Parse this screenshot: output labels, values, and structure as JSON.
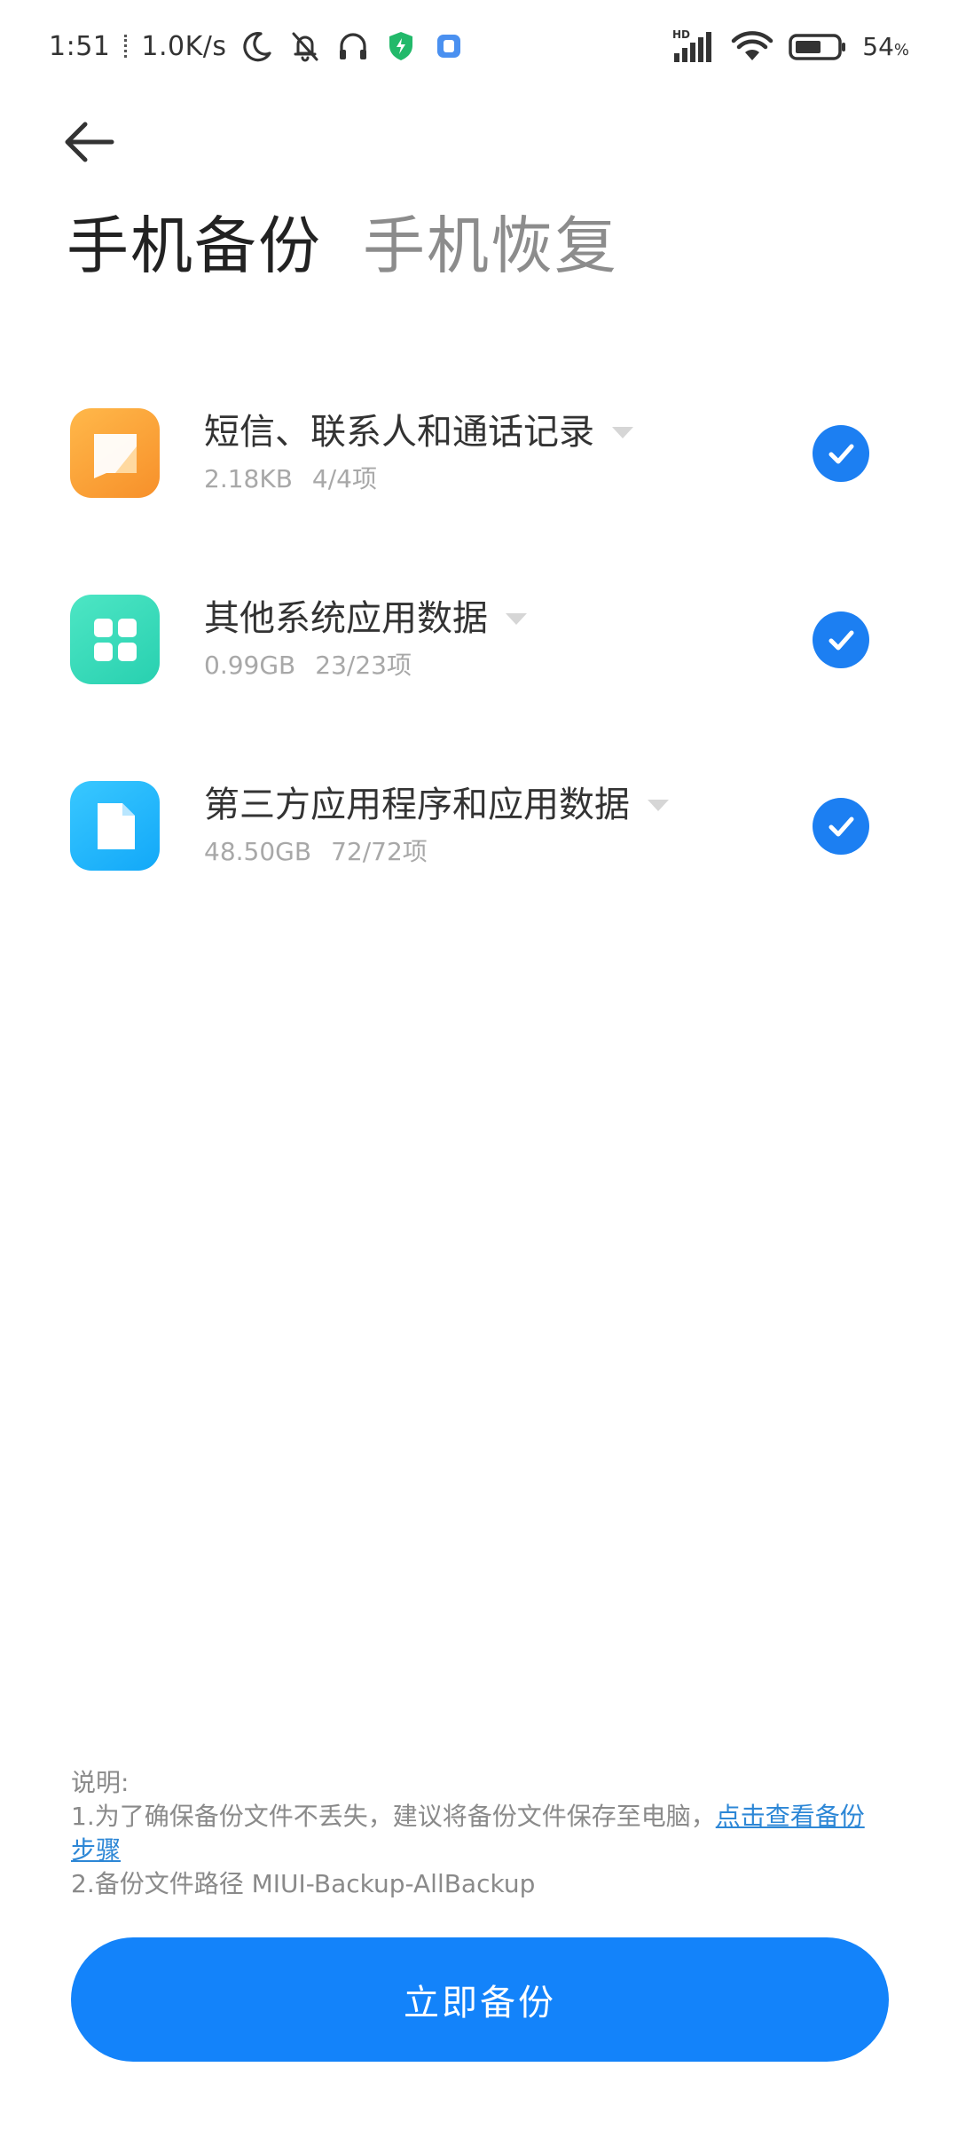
{
  "status_bar": {
    "time": "1:51",
    "net_speed": "1.0K/s",
    "signal_label": "HD",
    "battery_pct": "54",
    "battery_unit": "%",
    "icons": [
      "moon-icon",
      "bell-off-icon",
      "headphones-icon",
      "shield-icon",
      "app-notification-icon",
      "signal-icon",
      "wifi-icon",
      "battery-icon"
    ]
  },
  "header": {
    "back_icon": "arrow-left-icon",
    "tabs": [
      {
        "label": "手机备份",
        "active": true
      },
      {
        "label": "手机恢复",
        "active": false
      }
    ]
  },
  "items": [
    {
      "title": "短信、联系人和通话记录",
      "size": "2.18KB",
      "count": "4/4项",
      "icon": "message-icon",
      "icon_color": "#f7902a",
      "checked": true
    },
    {
      "title": "其他系统应用数据",
      "size": "0.99GB",
      "count": "23/23项",
      "icon": "apps-grid-icon",
      "icon_color": "#28d0b0",
      "checked": true
    },
    {
      "title": "第三方应用程序和应用数据",
      "size": "48.50GB",
      "count": "72/72项",
      "icon": "document-icon",
      "icon_color": "#12a8f8",
      "checked": true
    }
  ],
  "notes": {
    "heading": "说明:",
    "line1": "1.为了确保备份文件不丢失，建议将备份文件保存至电脑，",
    "line1_link": "点击查看备份步骤",
    "line2": "2.备份文件路径 MIUI-Backup-AllBackup"
  },
  "action": {
    "label": "立即备份",
    "color": "#1383fa"
  }
}
